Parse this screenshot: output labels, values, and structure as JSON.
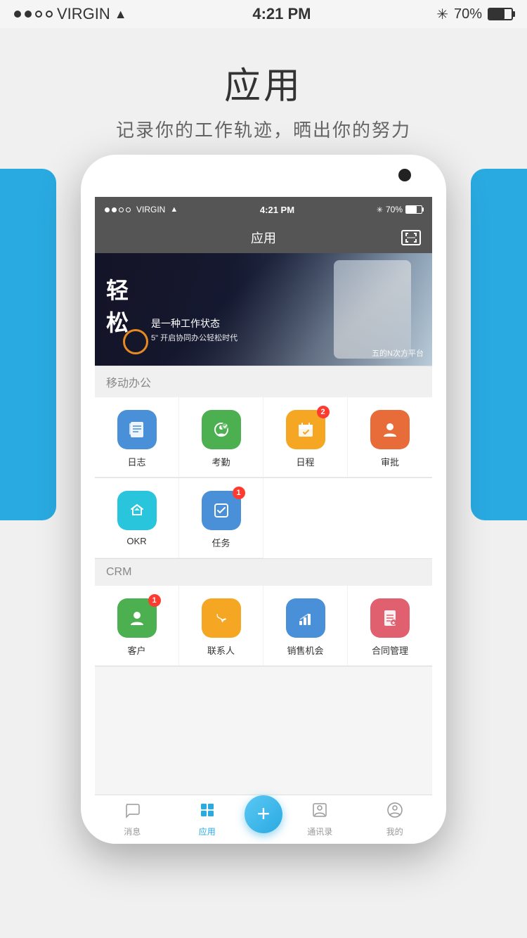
{
  "statusBar": {
    "carrier": "VIRGIN",
    "time": "4:21 PM",
    "battery": "70%"
  },
  "pageHeader": {
    "title": "应用",
    "subtitle": "记录你的工作轨迹，晒出你的努力"
  },
  "innerPhone": {
    "navbar": {
      "title": "应用"
    },
    "banner": {
      "bigText": "轻",
      "bigText2": "松",
      "tagline": "是一种工作状态",
      "desc": "5\" 开启协同办公轻松时代",
      "platform": "五的N次方平台"
    },
    "sections": [
      {
        "label": "移动办公",
        "apps": [
          {
            "name": "日志",
            "color": "#4a90d9",
            "icon": "📋",
            "badge": null
          },
          {
            "name": "考勤",
            "color": "#4caf50",
            "icon": "📍",
            "badge": null
          },
          {
            "name": "日程",
            "color": "#f5a623",
            "icon": "📅",
            "badge": "2"
          },
          {
            "name": "审批",
            "color": "#e86c3a",
            "icon": "👤",
            "badge": null
          }
        ]
      },
      {
        "label": "",
        "apps": [
          {
            "name": "OKR",
            "color": "#29c5dc",
            "icon": "✈️",
            "badge": null
          },
          {
            "name": "任务",
            "color": "#4a90d9",
            "icon": "✅",
            "badge": "1"
          }
        ]
      }
    ],
    "crmSection": {
      "label": "CRM",
      "apps": [
        {
          "name": "客户",
          "color": "#4caf50",
          "icon": "👤",
          "badge": "1"
        },
        {
          "name": "联系人",
          "color": "#f5a623",
          "icon": "📞",
          "badge": null
        },
        {
          "name": "销售机会",
          "color": "#4a90d9",
          "icon": "📊",
          "badge": null
        },
        {
          "name": "合同管理",
          "color": "#e06070",
          "icon": "📄",
          "badge": null
        }
      ]
    },
    "tabBar": {
      "items": [
        {
          "label": "消息",
          "icon": "💬",
          "active": false
        },
        {
          "label": "应用",
          "icon": "⚙️",
          "active": true
        },
        {
          "label": "+",
          "icon": "+",
          "active": false,
          "isPlus": true
        },
        {
          "label": "通讯录",
          "icon": "👥",
          "active": false
        },
        {
          "label": "我的",
          "icon": "👤",
          "active": false
        }
      ]
    }
  }
}
